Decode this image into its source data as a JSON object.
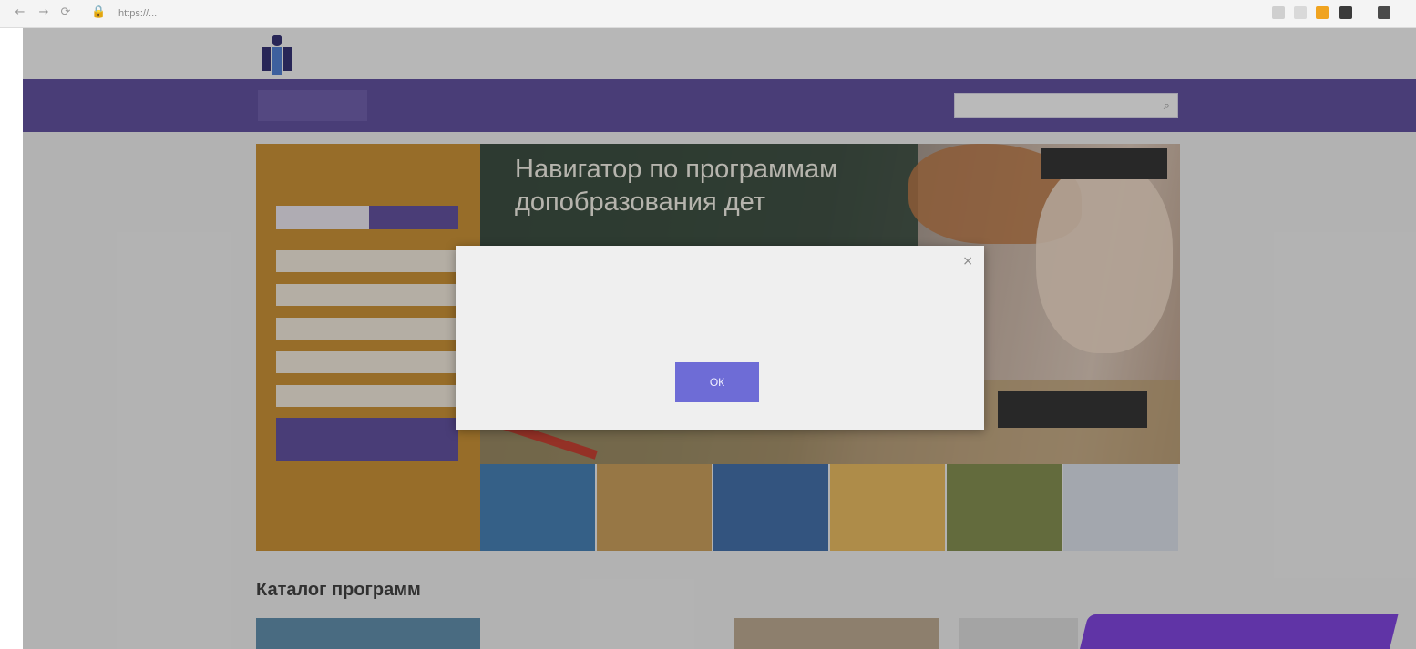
{
  "browser": {
    "address": "https://...",
    "back_icon": "arrow-left-icon",
    "forward_icon": "arrow-right-icon",
    "reload_icon": "reload-icon"
  },
  "header": {
    "org_lines": [
      "",
      "",
      ""
    ],
    "top_link": ""
  },
  "menu": {
    "items": [
      "",
      "",
      "",
      "",
      "",
      ""
    ],
    "search_placeholder": ""
  },
  "filter_panel": {
    "title": "",
    "toggle_left": "",
    "toggle_right": "",
    "fields": [
      "",
      "",
      "",
      "",
      ""
    ],
    "find_button": ""
  },
  "hero": {
    "title": "Навигатор по программам допобразования дет",
    "top_button": "",
    "more_button": ""
  },
  "thumbnails": [
    {
      "label": "",
      "color": "#3f7bb0"
    },
    {
      "label": "",
      "color": "#c79a55"
    },
    {
      "label": "",
      "color": "#3c6aa6"
    },
    {
      "label": "",
      "color": "#e7b85a"
    },
    {
      "label": "",
      "color": "#7f8a4a"
    },
    {
      "label": "",
      "color": "#d7dde6"
    }
  ],
  "catalog": {
    "title": "Каталог программ",
    "cards": [
      "",
      "",
      "",
      ""
    ]
  },
  "consult_widget": {
    "label": "",
    "action": ""
  },
  "modal": {
    "title": "",
    "text": "",
    "ok_button": "ОК"
  },
  "colors": {
    "menu_bg": "#5b4a9a",
    "panel_bg": "#c78d2e",
    "ok_button": "#6e6cd6",
    "consult_bg": "#7a3ddb"
  }
}
